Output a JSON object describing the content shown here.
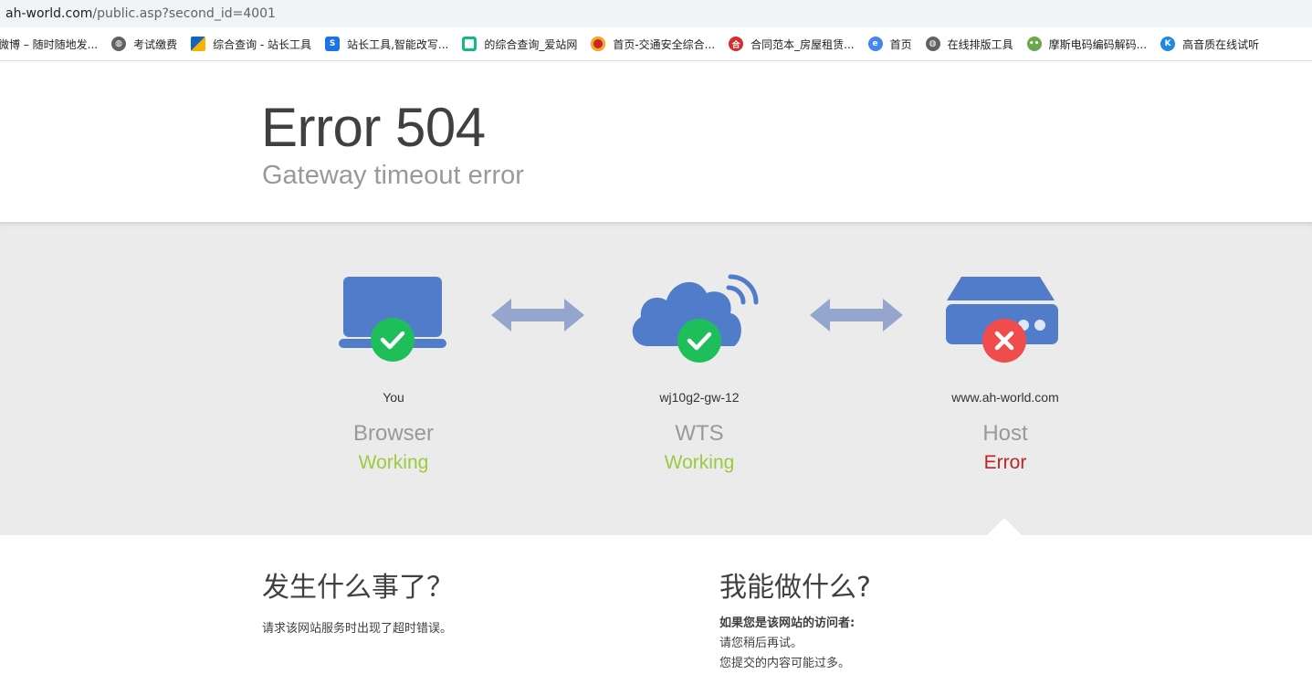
{
  "browser": {
    "url_host": "ah-world.com",
    "url_path": "/public.asp?second_id=4001",
    "bookmarks": [
      {
        "label": "微博 – 随时随地发...",
        "icon": "none"
      },
      {
        "label": "考试缴费",
        "icon": "globe-icon"
      },
      {
        "label": "综合查询 - 站长工具",
        "icon": "chinaz-icon"
      },
      {
        "label": "站长工具,智能改写...",
        "icon": "s-icon"
      },
      {
        "label": "的综合查询_爱站网",
        "icon": "aizhan-icon"
      },
      {
        "label": "首页-交通安全综合...",
        "icon": "police-icon"
      },
      {
        "label": "合同范本_房屋租赁...",
        "icon": "contract-icon"
      },
      {
        "label": "首页",
        "icon": "swirl-icon"
      },
      {
        "label": "在线排版工具",
        "icon": "globe-icon"
      },
      {
        "label": "摩斯电码编码解码...",
        "icon": "frog-icon"
      },
      {
        "label": "高音质在线试听",
        "icon": "k-icon"
      }
    ]
  },
  "header": {
    "title": "Error 504",
    "subtitle": "Gateway timeout error"
  },
  "status": {
    "nodes": [
      {
        "sub": "You",
        "name": "Browser",
        "state": "Working",
        "state_color": "#9bca3e",
        "icon": "laptop-icon",
        "badge": "ok"
      },
      {
        "sub": "wj10g2-gw-12",
        "name": "WTS",
        "state": "Working",
        "state_color": "#9bca3e",
        "icon": "cloud-icon",
        "badge": "ok"
      },
      {
        "sub": "www.ah-world.com",
        "name": "Host",
        "state": "Error",
        "state_color": "#bd2426",
        "icon": "server-icon",
        "badge": "error"
      }
    ],
    "colors": {
      "icon_blue": "#517cc9",
      "ok_green": "#1ebf5a",
      "error_red": "#f14c4c",
      "arrow": "#94a6cd"
    }
  },
  "what_happened": {
    "heading": "发生什么事了？",
    "text": "请求该网站服务时出现了超时错误。"
  },
  "what_can_i_do": {
    "heading": "我能做什么?",
    "label": "如果您是该网站的访问者:",
    "lines": [
      "请您稍后再试。",
      "您提交的内容可能过多。"
    ]
  }
}
